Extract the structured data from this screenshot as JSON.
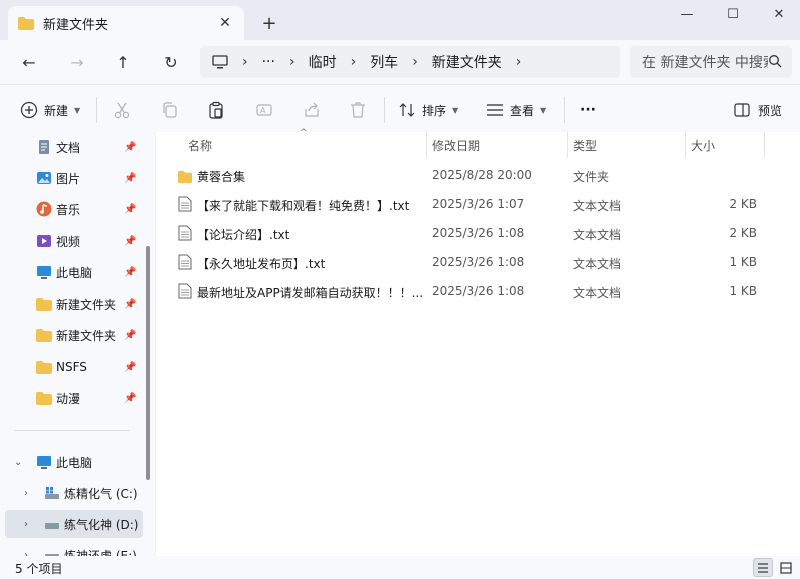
{
  "tab": {
    "title": "新建文件夹",
    "close_glyph": "✕",
    "new_tab_glyph": "+"
  },
  "window": {
    "minimize_glyph": "—",
    "maximize_glyph": "☐",
    "close_glyph": "✕"
  },
  "nav": {
    "back_glyph": "←",
    "forward_glyph": "→",
    "up_glyph": "↑",
    "refresh_glyph": "↻",
    "breadcrumb": [
      "临时",
      "列车",
      "新建文件夹"
    ],
    "ellipsis": "···",
    "search_placeholder": "在 新建文件夹 中搜索"
  },
  "toolbar": {
    "new_label": "新建",
    "sort_label": "排序",
    "view_label": "查看",
    "more_label": "···",
    "preview_label": "预览"
  },
  "sidebar": {
    "quick_access": [
      {
        "label": "文档",
        "icon": "documents-icon"
      },
      {
        "label": "图片",
        "icon": "pictures-icon"
      },
      {
        "label": "音乐",
        "icon": "music-icon"
      },
      {
        "label": "视频",
        "icon": "videos-icon"
      },
      {
        "label": "此电脑",
        "icon": "computer-icon"
      },
      {
        "label": "新建文件夹",
        "icon": "folder-icon"
      },
      {
        "label": "新建文件夹",
        "icon": "folder-icon"
      },
      {
        "label": "NSFS",
        "icon": "folder-icon"
      },
      {
        "label": "动漫",
        "icon": "folder-icon"
      }
    ],
    "this_pc": "此电脑",
    "drives": [
      "炼精化气 (C:)",
      "练气化神 (D:)",
      "炼神还虚 (E:)"
    ]
  },
  "columns": {
    "name": "名称",
    "date": "修改日期",
    "type": "类型",
    "size": "大小"
  },
  "files": [
    {
      "name": "黄蓉合集",
      "date": "2025/8/28 20:00",
      "type": "文件夹",
      "size": "",
      "kind": "folder"
    },
    {
      "name": "【来了就能下载和观看！纯免费！】.txt",
      "date": "2025/3/26 1:07",
      "type": "文本文档",
      "size": "2 KB",
      "kind": "text"
    },
    {
      "name": "【论坛介绍】.txt",
      "date": "2025/3/26 1:08",
      "type": "文本文档",
      "size": "2 KB",
      "kind": "text"
    },
    {
      "name": "【永久地址发布页】.txt",
      "date": "2025/3/26 1:08",
      "type": "文本文档",
      "size": "1 KB",
      "kind": "text"
    },
    {
      "name": "最新地址及APP请发邮箱自动获取！！！...",
      "date": "2025/3/26 1:08",
      "type": "文本文档",
      "size": "1 KB",
      "kind": "text"
    }
  ],
  "status": {
    "item_count": "5 个项目"
  },
  "colors": {
    "folder": "#f2c14e",
    "accent": "#0a64c8",
    "selected": "#dfe3ea"
  }
}
